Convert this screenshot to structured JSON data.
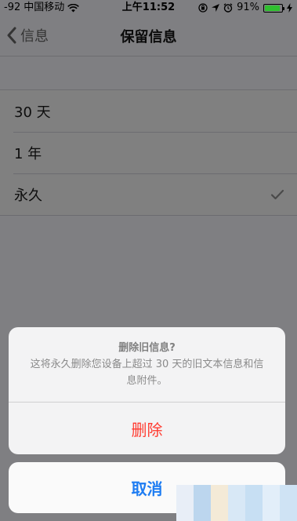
{
  "status_bar": {
    "signal": "-92",
    "carrier": "中国移动",
    "time": "上午11:52",
    "battery": "91%",
    "icons": [
      "wifi-icon",
      "orientation-lock-icon",
      "location-icon",
      "alarm-icon",
      "battery-icon",
      "charging-icon"
    ],
    "battery_level": 0.91,
    "battery_color": "#2fbf2f"
  },
  "nav": {
    "back_label": "信息",
    "title": "保留信息"
  },
  "options": [
    {
      "label": "30 天",
      "selected": false
    },
    {
      "label": "1 年",
      "selected": false
    },
    {
      "label": "永久",
      "selected": true
    }
  ],
  "action_sheet": {
    "title": "删除旧信息?",
    "message": "这将永久删除您设备上超过 30 天的旧文本信息和信息附件。",
    "delete_label": "删除",
    "cancel_label": "取消"
  },
  "colors": {
    "destructive": "#ff3b30",
    "accent": "#1d7cf2",
    "overlay": "#7f7f82"
  }
}
